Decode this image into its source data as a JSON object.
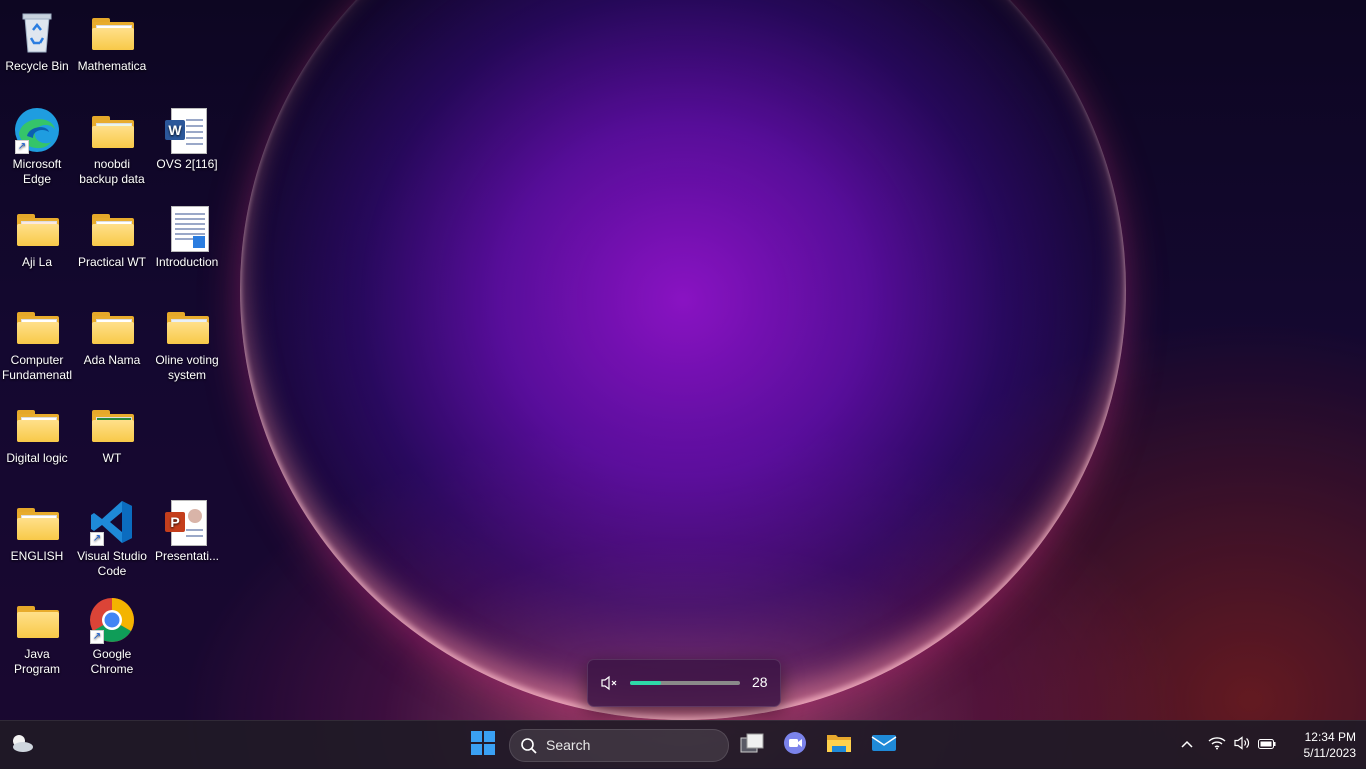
{
  "desktop": {
    "icons": [
      {
        "id": "recycle-bin",
        "label": "Recycle Bin"
      },
      {
        "id": "mathematica",
        "label": "Mathematica"
      },
      {
        "id": "edge",
        "label": "Microsoft Edge"
      },
      {
        "id": "noobdi",
        "label": "noobdi backup data"
      },
      {
        "id": "ovs",
        "label": "OVS 2[116]"
      },
      {
        "id": "aji-la",
        "label": "Aji La"
      },
      {
        "id": "practical-wt",
        "label": "Practical WT"
      },
      {
        "id": "introduction",
        "label": "Introduction"
      },
      {
        "id": "computer-fund",
        "label": "Computer Fundamenatl"
      },
      {
        "id": "ada-nama",
        "label": "Ada Nama"
      },
      {
        "id": "online-voting",
        "label": "Oline voting system"
      },
      {
        "id": "digital-logic",
        "label": "Digital logic"
      },
      {
        "id": "wt",
        "label": "WT"
      },
      {
        "id": "english",
        "label": "ENGLISH"
      },
      {
        "id": "vscode",
        "label": "Visual Studio Code"
      },
      {
        "id": "presentation",
        "label": "Presentati..."
      },
      {
        "id": "java-program",
        "label": "Java Program"
      },
      {
        "id": "chrome",
        "label": "Google Chrome"
      }
    ]
  },
  "volume_flyout": {
    "value": "28",
    "level": 0.28,
    "icon": "speaker-muted-icon",
    "accent": "#2ed8a8"
  },
  "taskbar": {
    "search_label": "Search",
    "pinned": [
      "start-icon",
      "task-view-icon",
      "teams-chat-icon",
      "file-explorer-icon",
      "mail-icon"
    ],
    "time": "12:34 PM",
    "date": "5/11/2023"
  }
}
